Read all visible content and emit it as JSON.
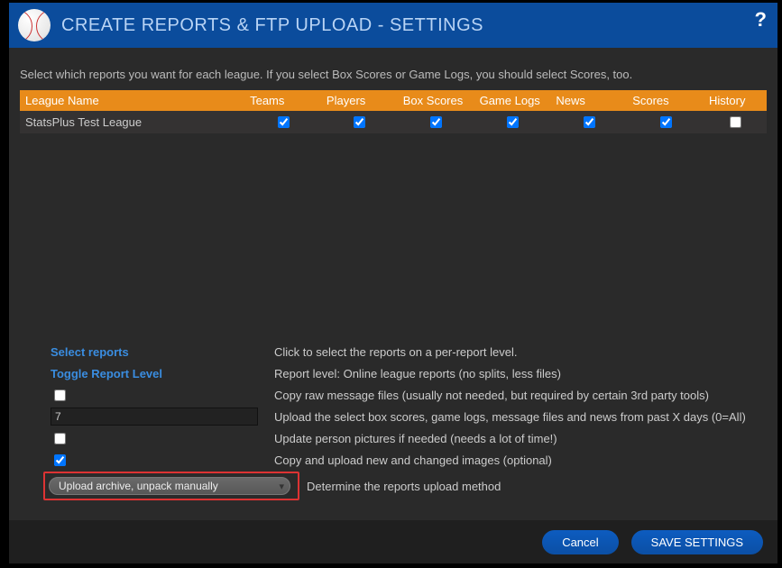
{
  "header": {
    "title": "CREATE REPORTS & FTP UPLOAD - SETTINGS"
  },
  "hint": "Select which reports you want for each league. If you select Box Scores or Game Logs, you should select Scores, too.",
  "table": {
    "headers": {
      "league": "League Name",
      "teams": "Teams",
      "players": "Players",
      "box": "Box Scores",
      "game": "Game Logs",
      "news": "News",
      "scores": "Scores",
      "history": "History"
    },
    "row": {
      "league": "StatsPlus Test League",
      "teams": true,
      "players": true,
      "box": true,
      "game": true,
      "news": true,
      "scores": true,
      "history": false
    }
  },
  "options": {
    "select_reports_label": "Select reports",
    "select_reports_desc": "Click to select the reports on a per-report level.",
    "toggle_level_label": "Toggle Report Level",
    "toggle_level_desc": "Report level: Online league reports (no splits, less files)",
    "copy_raw_desc": "Copy raw message files (usually not needed, but required by certain 3rd party tools)",
    "days_value": "7",
    "days_desc": "Upload the select box scores, game logs, message files and news from past X days (0=All)",
    "update_pics_desc": "Update person pictures if needed (needs a lot of time!)",
    "copy_images_desc": "Copy and upload new and changed images (optional)",
    "dropdown_value": "Upload archive, unpack manually",
    "dropdown_desc": "Determine the reports upload method"
  },
  "footer": {
    "cancel": "Cancel",
    "save": "SAVE SETTINGS"
  }
}
